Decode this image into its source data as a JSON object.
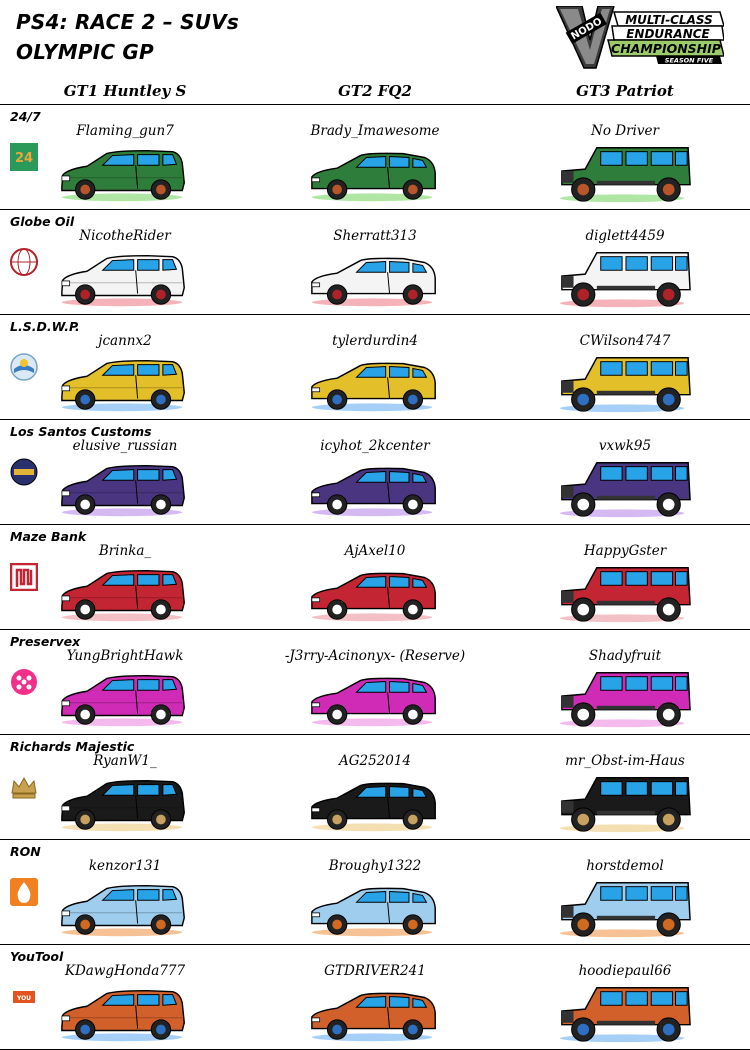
{
  "header": {
    "title_line1": "PS4: RACE 2 – SUVs",
    "title_line2": "OLYMPIC GP",
    "logo": {
      "line1": "MULTI-CLASS",
      "line2": "ENDURANCE",
      "line3": "CHAMPIONSHIP",
      "line4": "SEASON FIVE",
      "badge": "NODO"
    }
  },
  "columns": [
    {
      "label": "GT1 Huntley S",
      "car": "huntley"
    },
    {
      "label": "GT2 FQ2",
      "car": "fq2"
    },
    {
      "label": "GT3 Patriot",
      "car": "patriot"
    }
  ],
  "teams": [
    {
      "name": "24/7",
      "logo_icon": "247-icon",
      "color": "#2f7d3a",
      "wheel": "#b8562a",
      "glow": "#9be08c",
      "drivers": [
        "Flaming_gun7",
        "Brady_Imawesome",
        "No Driver"
      ]
    },
    {
      "name": "Globe Oil",
      "logo_icon": "globe-oil-icon",
      "color": "#f4f4f4",
      "wheel": "#b0222a",
      "glow": "#f2a0a8",
      "drivers": [
        "NicotheRider",
        "Sherratt313",
        "diglett4459"
      ]
    },
    {
      "name": "L.S.D.W.P.",
      "logo_icon": "lsdwp-icon",
      "color": "#e3bf2a",
      "wheel": "#2e6fc2",
      "glow": "#8fc3f5",
      "drivers": [
        "jcannx2",
        "tylerdurdin4",
        "CWilson4747"
      ]
    },
    {
      "name": "Los Santos Customs",
      "logo_icon": "ls-customs-icon",
      "color": "#4a3580",
      "wheel": "#ffffff",
      "glow": "#c9a7f0",
      "drivers": [
        "elusive_russian",
        "icyhot_2kcenter",
        "vxwk95"
      ]
    },
    {
      "name": "Maze Bank",
      "logo_icon": "maze-bank-icon",
      "color": "#c42533",
      "wheel": "#ffffff",
      "glow": "#f0b0b8",
      "drivers": [
        "Brinka_",
        "AjAxel10",
        "HappyGster"
      ]
    },
    {
      "name": "Preservex",
      "logo_icon": "preservex-icon",
      "color": "#cf2bb6",
      "wheel": "#ffffff",
      "glow": "#f3a9e8",
      "drivers": [
        "YungBrightHawk",
        "-J3rry-Acinonyx- (Reserve)",
        "Shadyfruit"
      ]
    },
    {
      "name": "Richards Majestic",
      "logo_icon": "crown-icon",
      "color": "#1a1a1a",
      "wheel": "#c8a060",
      "glow": "#f1d7a0",
      "drivers": [
        "RyanW1_",
        "AG252014",
        "mr_Obst-im-Haus"
      ]
    },
    {
      "name": "RON",
      "logo_icon": "ron-icon",
      "color": "#9ecdee",
      "wheel": "#d06a20",
      "glow": "#f4b37a",
      "drivers": [
        "kenzor131",
        "Broughy1322",
        "horstdemol"
      ]
    },
    {
      "name": "YouTool",
      "logo_icon": "youtool-icon",
      "color": "#d1602a",
      "wheel": "#2e6fc2",
      "glow": "#8fc3f5",
      "drivers": [
        "KDawgHonda777",
        "GTDRIVER241",
        "hoodiepaul66"
      ]
    }
  ]
}
